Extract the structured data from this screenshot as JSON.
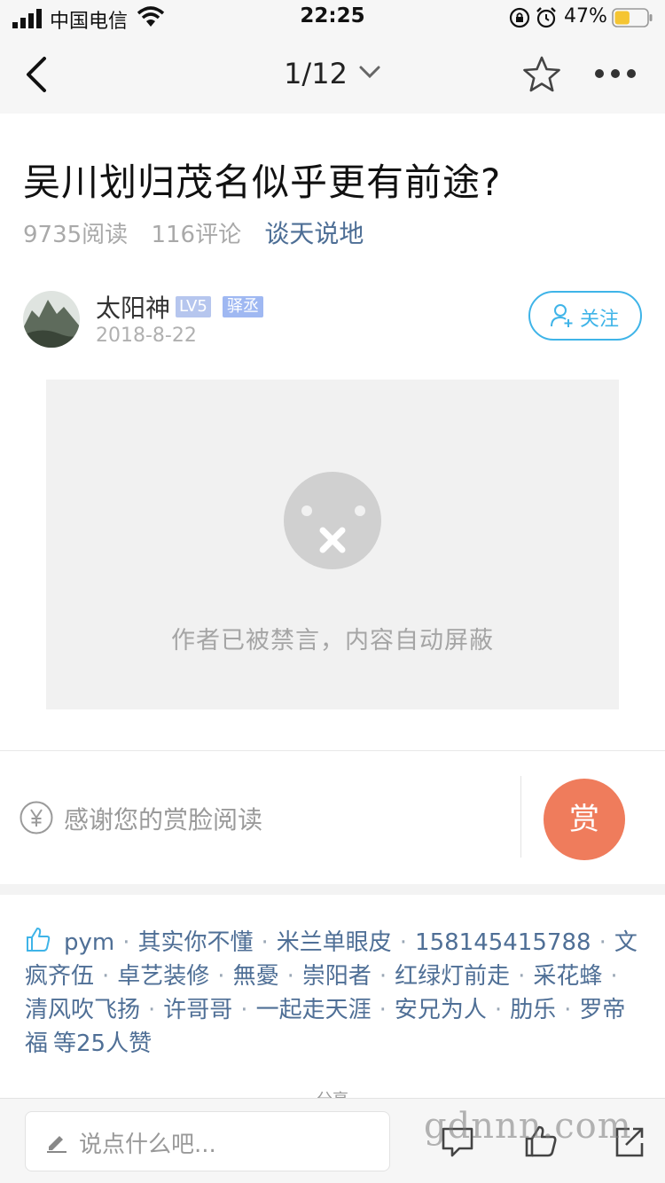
{
  "status_bar": {
    "carrier": "中国电信",
    "time": "22:25",
    "battery_percent": "47%",
    "battery_level": 0.47,
    "battery_color": "#f5c533"
  },
  "nav": {
    "pager": "1/12",
    "icons": [
      "back-icon",
      "chevron-down-icon",
      "star-icon",
      "more-icon"
    ]
  },
  "article": {
    "title": "吴川划归茂名似乎更有前途?",
    "reads": "9735阅读",
    "comments": "116评论",
    "category": "谈天说地"
  },
  "author": {
    "name": "太阳神",
    "level": "LV5",
    "rank": "驿丞",
    "date": "2018-8-22",
    "follow_label": "关注"
  },
  "content": {
    "blocked_message": "作者已被禁言，内容自动屏蔽"
  },
  "reward": {
    "prompt": "感谢您的赏脸阅读",
    "button_label": "赏",
    "button_color": "#ef7c5c"
  },
  "likes": {
    "users": [
      "pym",
      "其实你不懂",
      "米兰单眼皮",
      "158145415788",
      "文疯齐伍",
      "卓艺装修",
      "無憂",
      "崇阳者",
      "红绿灯前走",
      "采花蜂",
      "清风吹飞扬",
      "许哥哥",
      "一起走天涯",
      "安兄为人",
      "肋乐",
      "罗帝福"
    ],
    "count_text": "等25人赞",
    "color": "#4f6f96"
  },
  "share_peek": "分享",
  "bottom_bar": {
    "comment_placeholder": "说点什么吧...",
    "watermark": "gdnnn.com",
    "icons": [
      "comment-icon",
      "like-icon",
      "share-icon"
    ]
  },
  "colors": {
    "accent_blue": "#3fb4e8",
    "link_blue": "#4f6f96",
    "placeholder_gray": "#f1f1f1"
  }
}
